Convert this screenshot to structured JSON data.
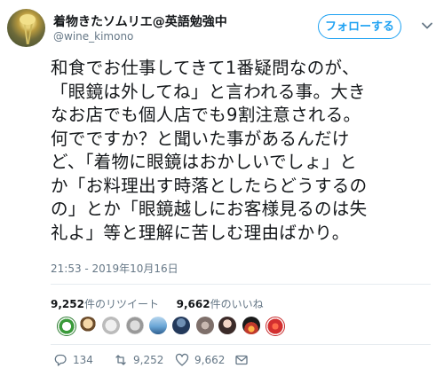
{
  "user": {
    "display_name": "着物きたソムリエ@英語勉強中",
    "handle": "@wine_kimono"
  },
  "follow_label": "フォローする",
  "tweet": {
    "lines": [
      "和食でお仕事してきて1番疑問なのが、",
      "「眼鏡は外してね」と言われる事。大き",
      "なお店でも個人店でも9割注意される。",
      "何でですか？と聞いた事があるんだけ",
      "ど、「着物に眼鏡はおかしいでしょ」と",
      "か「お料理出す時落としたらどうするの",
      "の」とか「眼鏡越しにお客様見るのは失",
      "礼よ」等と理解に苦しむ理由ばかり。"
    ],
    "timestamp": "21:53 - 2019年10月16日"
  },
  "stats": {
    "retweets_count": "9,252",
    "retweets_label": "件のリツイート",
    "likes_count": "9,662",
    "likes_label": "件のいいね"
  },
  "actions": {
    "replies": "134",
    "retweets": "9,252",
    "likes": "9,662"
  },
  "colors": {
    "accent": "#1da1f2",
    "muted": "#657786",
    "divider": "#e6ecf0"
  },
  "liker_avatars": [
    "green-ring",
    "cartoon",
    "sketch",
    "gray-face",
    "sky",
    "dark-blue",
    "blurred",
    "portrait",
    "sunset",
    "red-circle"
  ]
}
